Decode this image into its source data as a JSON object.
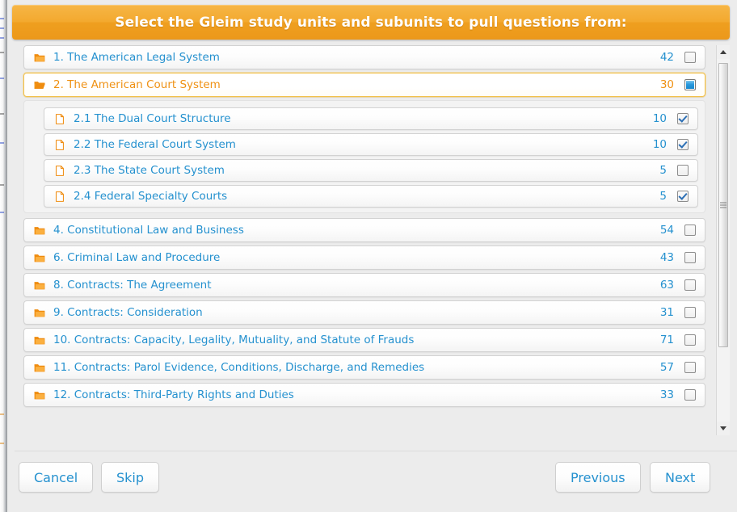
{
  "header": {
    "title": "Select the Gleim study units and subunits to pull questions from:",
    "bg_color": "#ef9f1f",
    "text_color": "#ffffff"
  },
  "colors": {
    "link_blue": "#2591cf",
    "selected_orange": "#ef9114",
    "folder_orange": "#ef8c10",
    "panel_bg": "#ececec"
  },
  "list": {
    "items": [
      {
        "id": "unit-1",
        "label": "1. The American Legal System",
        "count": "42",
        "icon": "folder-closed-icon",
        "checkbox": "unchecked",
        "selected": false,
        "subunits": []
      },
      {
        "id": "unit-2",
        "label": "2. The American Court System",
        "count": "30",
        "icon": "folder-open-icon",
        "checkbox": "indeterminate",
        "selected": true,
        "subunits": [
          {
            "id": "subunit-2-1",
            "label": "2.1 The Dual Court Structure",
            "count": "10",
            "icon": "document-icon",
            "checkbox": "checked"
          },
          {
            "id": "subunit-2-2",
            "label": "2.2 The Federal Court System",
            "count": "10",
            "icon": "document-icon",
            "checkbox": "checked"
          },
          {
            "id": "subunit-2-3",
            "label": "2.3 The State Court System",
            "count": "5",
            "icon": "document-icon",
            "checkbox": "unchecked"
          },
          {
            "id": "subunit-2-4",
            "label": "2.4 Federal Specialty Courts",
            "count": "5",
            "icon": "document-icon",
            "checkbox": "checked"
          }
        ]
      },
      {
        "id": "unit-4",
        "label": "4. Constitutional Law and Business",
        "count": "54",
        "icon": "folder-closed-icon",
        "checkbox": "unchecked",
        "selected": false,
        "subunits": []
      },
      {
        "id": "unit-6",
        "label": "6. Criminal Law and Procedure",
        "count": "43",
        "icon": "folder-closed-icon",
        "checkbox": "unchecked",
        "selected": false,
        "subunits": []
      },
      {
        "id": "unit-8",
        "label": "8. Contracts: The Agreement",
        "count": "63",
        "icon": "folder-closed-icon",
        "checkbox": "unchecked",
        "selected": false,
        "subunits": []
      },
      {
        "id": "unit-9",
        "label": "9. Contracts: Consideration",
        "count": "31",
        "icon": "folder-closed-icon",
        "checkbox": "unchecked",
        "selected": false,
        "subunits": []
      },
      {
        "id": "unit-10",
        "label": "10. Contracts: Capacity, Legality, Mutuality, and Statute of Frauds",
        "count": "71",
        "icon": "folder-closed-icon",
        "checkbox": "unchecked",
        "selected": false,
        "subunits": []
      },
      {
        "id": "unit-11",
        "label": "11. Contracts: Parol Evidence, Conditions, Discharge, and Remedies",
        "count": "57",
        "icon": "folder-closed-icon",
        "checkbox": "unchecked",
        "selected": false,
        "subunits": []
      },
      {
        "id": "unit-12",
        "label": "12. Contracts: Third-Party Rights and Duties",
        "count": "33",
        "icon": "folder-closed-icon",
        "checkbox": "unchecked",
        "selected": false,
        "subunits": []
      }
    ]
  },
  "scrollbar": {
    "up_arrow": "scroll-up-arrow-icon",
    "down_arrow": "scroll-down-arrow-icon",
    "thumb": "scroll-thumb"
  },
  "footer": {
    "cancel_label": "Cancel",
    "skip_label": "Skip",
    "previous_label": "Previous",
    "next_label": "Next"
  }
}
